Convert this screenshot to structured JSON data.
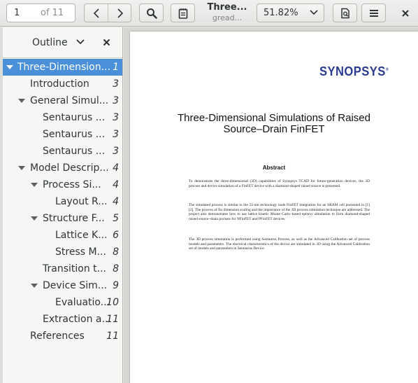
{
  "toolbar": {
    "page_value": "1",
    "page_of": "of 11",
    "doc_title": "Three...",
    "doc_subtitle": "gread...",
    "zoom_value": "51.82%"
  },
  "sidebar": {
    "title": "Outline",
    "items": [
      {
        "label": "Three-Dimension...",
        "page": "1",
        "level": 0,
        "expander": true,
        "selected": true
      },
      {
        "label": "Introduction",
        "page": "3",
        "level": 1,
        "expander": false
      },
      {
        "label": "General Simul...",
        "page": "3",
        "level": 1,
        "expander": true
      },
      {
        "label": "Sentaurus ...",
        "page": "3",
        "level": 2,
        "expander": false
      },
      {
        "label": "Sentaurus ...",
        "page": "3",
        "level": 2,
        "expander": false
      },
      {
        "label": "Sentaurus ...",
        "page": "3",
        "level": 2,
        "expander": false
      },
      {
        "label": "Model Descrip...",
        "page": "4",
        "level": 1,
        "expander": true
      },
      {
        "label": "Process Si...",
        "page": "4",
        "level": 2,
        "expander": true
      },
      {
        "label": "Layout R...",
        "page": "4",
        "level": 3,
        "expander": false
      },
      {
        "label": "Structure F...",
        "page": "5",
        "level": 2,
        "expander": true
      },
      {
        "label": "Lattice K...",
        "page": "6",
        "level": 3,
        "expander": false
      },
      {
        "label": "Stress M...",
        "page": "8",
        "level": 3,
        "expander": false
      },
      {
        "label": "Transition t...",
        "page": "8",
        "level": 2,
        "expander": false
      },
      {
        "label": "Device Sim...",
        "page": "9",
        "level": 2,
        "expander": true
      },
      {
        "label": "Evaluatio...",
        "page": "10",
        "level": 3,
        "expander": false
      },
      {
        "label": "Extraction a...",
        "page": "11",
        "level": 2,
        "expander": false
      },
      {
        "label": "References",
        "page": "11",
        "level": 1,
        "expander": false
      }
    ]
  },
  "document": {
    "logo_text": "SYNOPSYS",
    "logo_reg": "®",
    "title_line1": "Three-Dimensional Simulations of Raised",
    "title_line2": "Source–Drain FinFET",
    "abstract_heading": "Abstract",
    "paragraphs": [
      "To demonstrate the three-dimensional (3D) capabilities of Synopsys TCAD for future-generation devices, the 3D process and device simulation of a FinFET device with a diamond-shaped raised source is presented.",
      "The simulated process is similar to the 22-nm technology node FinFET integration for an SRAM cell presented in [1][2]. The process of fin dimension scaling and the importance of the 3D process simulation technique are addressed. The project also demonstrates how to use lattice kinetic Monte Carlo–based epitaxy simulation to form diamond-shaped raised source–drain pockets for NFinFET and PFinFET devices.",
      "The 3D process simulation is performed using Sentaurus Process, as well as the Advanced Calibration set of process models and parameters. The electrical characteristics of the device are simulated in 3D using the Advanced Calibration set of models and parameters in Sentaurus Device."
    ]
  },
  "colors": {
    "selection": "#4a90d9",
    "logo": "#2b3b8f",
    "link": "#3b4fd1"
  }
}
